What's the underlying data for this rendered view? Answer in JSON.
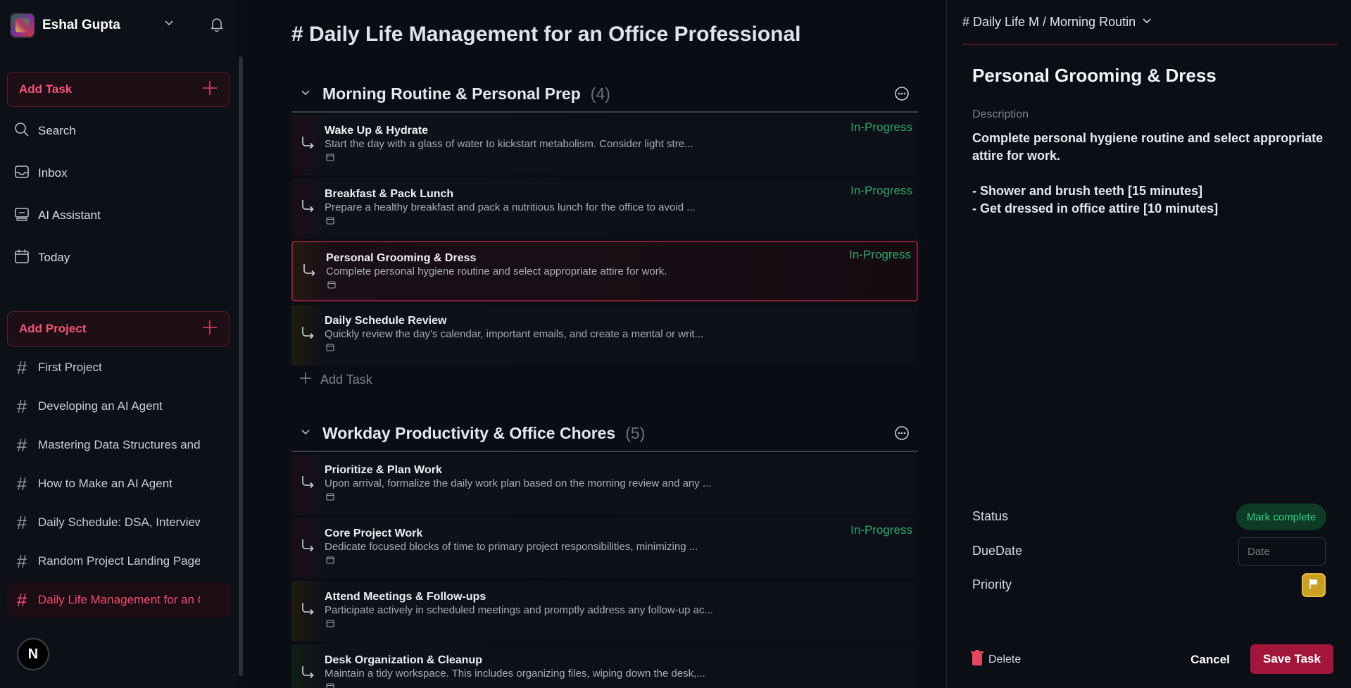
{
  "sidebar": {
    "user_name": "Eshal Gupta",
    "add_task_label": "Add Task",
    "nav": [
      {
        "label": "Search",
        "icon": "search-icon"
      },
      {
        "label": "Inbox",
        "icon": "inbox-icon"
      },
      {
        "label": "AI Assistant",
        "icon": "ai-assistant-icon"
      },
      {
        "label": "Today",
        "icon": "calendar-icon"
      }
    ],
    "add_project_label": "Add Project",
    "projects": [
      {
        "label": "First Project"
      },
      {
        "label": "Developing an AI Agent"
      },
      {
        "label": "Mastering Data Structures and ."
      },
      {
        "label": "How to Make an AI Agent"
      },
      {
        "label": "Daily Schedule: DSA, Interview."
      },
      {
        "label": "Random Project Landing Page ("
      },
      {
        "label": "Daily Life Management for an O",
        "active": true
      }
    ],
    "badge": "N"
  },
  "main": {
    "title": "# Daily Life Management for an Office Professional",
    "sections": [
      {
        "title": "Morning Routine & Personal Prep",
        "count": "(4)",
        "tasks": [
          {
            "title": "Wake Up & Hydrate",
            "desc": "Start the day with a glass of water to kickstart metabolism. Consider light stre...",
            "status": "In-Progress"
          },
          {
            "title": "Breakfast & Pack Lunch",
            "desc": "Prepare a healthy breakfast and pack a nutritious lunch for the office to avoid ...",
            "status": "In-Progress"
          },
          {
            "title": "Personal Grooming & Dress",
            "desc": "Complete personal hygiene routine and select appropriate attire for work.",
            "status": "In-Progress"
          },
          {
            "title": "Daily Schedule Review",
            "desc": "Quickly review the day's calendar, important emails, and create a mental or writ...",
            "status": ""
          }
        ],
        "add_task_label": "Add Task"
      },
      {
        "title": "Workday Productivity & Office Chores",
        "count": "(5)",
        "tasks": [
          {
            "title": "Prioritize & Plan Work",
            "desc": "Upon arrival, formalize the daily work plan based on the morning review and any ...",
            "status": ""
          },
          {
            "title": "Core Project Work",
            "desc": "Dedicate focused blocks of time to primary project responsibilities, minimizing ...",
            "status": "In-Progress"
          },
          {
            "title": "Attend Meetings & Follow-ups",
            "desc": "Participate actively in scheduled meetings and promptly address any follow-up ac...",
            "status": ""
          },
          {
            "title": "Desk Organization & Cleanup",
            "desc": "Maintain a tidy workspace. This includes organizing files, wiping down the desk,...",
            "status": ""
          }
        ]
      }
    ]
  },
  "panel": {
    "breadcrumb": "# Daily Life M / Morning Routin",
    "title": "Personal Grooming & Dress",
    "description_label": "Description",
    "description_lines": [
      "Complete personal hygiene routine and select appropriate attire for work.",
      "- Shower and brush teeth [15 minutes]",
      "- Get dressed in office attire [10 minutes]"
    ],
    "status_label": "Status",
    "mark_complete": "Mark complete",
    "duedate_label": "DueDate",
    "date_placeholder": "Date",
    "priority_label": "Priority",
    "delete_label": "Delete",
    "cancel_label": "Cancel",
    "save_label": "Save Task"
  },
  "colors": {
    "accent": "#f25677",
    "status_green": "#2fa66a",
    "save_button": "#a3163c",
    "priority_flag": "#c8a023"
  }
}
